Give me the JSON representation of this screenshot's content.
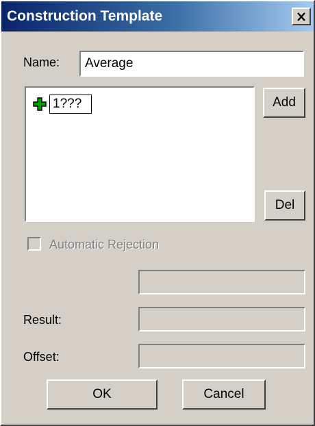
{
  "window": {
    "title": "Construction Template"
  },
  "name_field": {
    "label": "Name:",
    "value": "Average"
  },
  "tree": {
    "nodes": [
      {
        "label": "1???"
      }
    ]
  },
  "buttons": {
    "add": "Add",
    "del": "Del",
    "ok": "OK",
    "cancel": "Cancel"
  },
  "auto_rejection": {
    "label": "Automatic Rejection",
    "checked": false,
    "enabled": false
  },
  "fields": {
    "unlabeled_value": "",
    "result_label": "Result:",
    "result_value": "",
    "offset_label": "Offset:",
    "offset_value": ""
  },
  "icons": {
    "close": "close-icon",
    "tree_node": "plus-icon"
  },
  "colors": {
    "title_start": "#0a246a",
    "title_end": "#a6caf0",
    "dialog_bg": "#d4d0c8",
    "plus_green": "#00a000"
  }
}
